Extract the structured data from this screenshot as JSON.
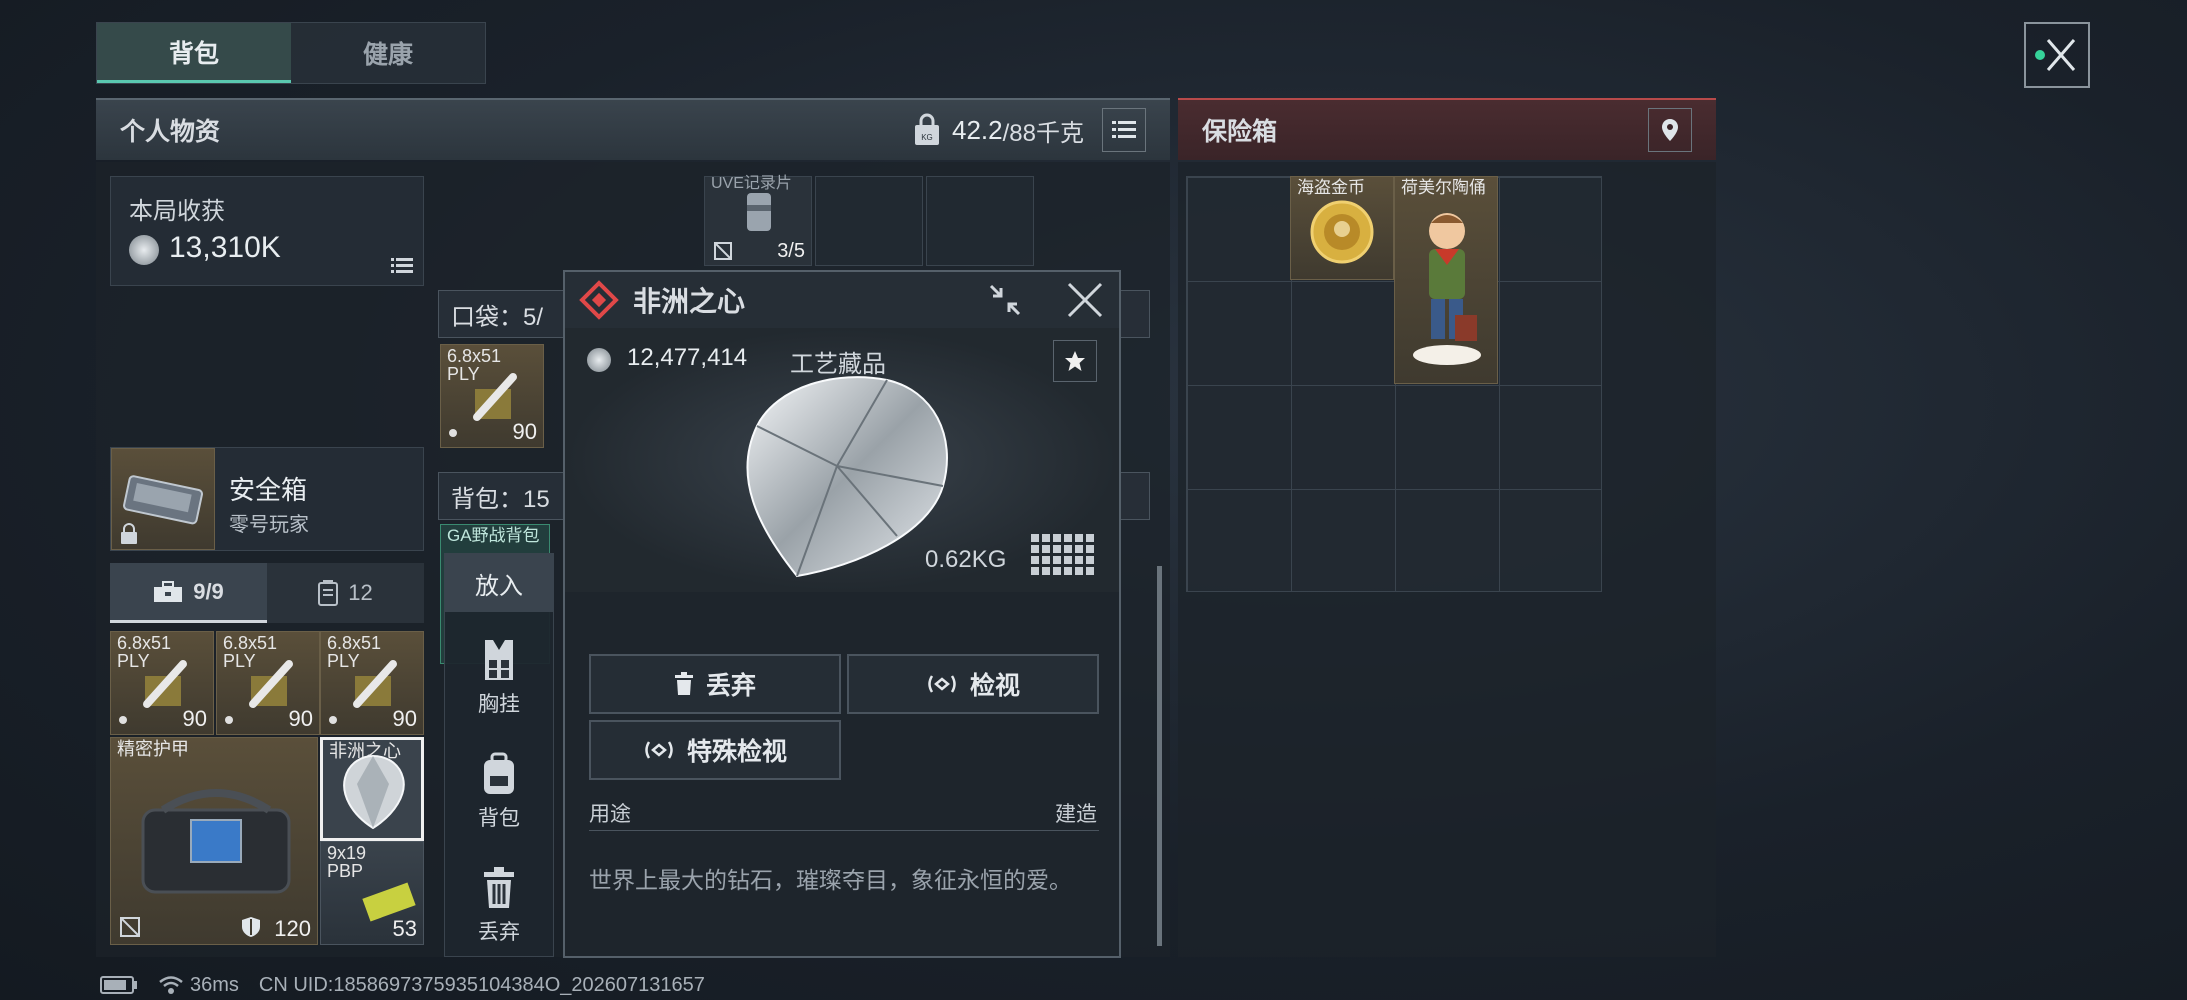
{
  "tabs": [
    {
      "label": "背包",
      "active": true
    },
    {
      "label": "健康",
      "active": false
    }
  ],
  "personal": {
    "title": "个人物资",
    "weight_current": "42.2",
    "weight_max": "/88千克",
    "harvest_label": "本局收获",
    "harvest_value": "13,310K",
    "safe_box": {
      "name": "安全箱",
      "owner": "零号玩家"
    },
    "loadout_tabs": [
      {
        "label": "9/9",
        "icon": "briefcase-icon"
      },
      {
        "label": "12",
        "icon": "locker-icon"
      }
    ],
    "top_item": {
      "label": "UVE记录片",
      "count": "3/5"
    },
    "pocket_label": "口袋：5/",
    "backpack_label": "背包：15",
    "pocket_item": {
      "label": "6.8x51\nPLY",
      "count": "90"
    },
    "rig_label": "GA野战背包",
    "grid_items": [
      {
        "label": "6.8x51\nPLY",
        "count": "90"
      },
      {
        "label": "6.8x51\nPLY",
        "count": "90"
      },
      {
        "label": "6.8x51\nPLY",
        "count": "90"
      }
    ],
    "armor": {
      "label": "精密护甲",
      "durability": "120"
    },
    "heart_item": {
      "label": "非洲之心"
    },
    "ammo_item": {
      "label": "9x19\nPBP",
      "count": "53"
    }
  },
  "actions": {
    "put_in": "放入",
    "items": [
      {
        "label": "胸挂",
        "icon": "vest-icon"
      },
      {
        "label": "背包",
        "icon": "backpack-icon"
      },
      {
        "label": "丢弃",
        "icon": "trash-icon"
      }
    ]
  },
  "popup": {
    "title": "非洲之心",
    "price": "12,477,414",
    "category": "工艺藏品",
    "weight": "0.62KG",
    "buttons": {
      "discard": "丢弃",
      "inspect": "检视",
      "special_inspect": "特殊检视"
    },
    "usage_label": "用途",
    "usage_value": "建造",
    "description": "世界上最大的钻石，璀璨夺目，象征永恒的爱。"
  },
  "safe": {
    "title": "保险箱",
    "items": [
      {
        "label": "海盗金币"
      },
      {
        "label": "荷美尔陶俑"
      }
    ]
  },
  "status": {
    "ping": "36ms",
    "uid": "CN UID:1858697375935104384O_202607131657"
  },
  "colors": {
    "accent_teal": "#5ac8b0",
    "safe_red": "#b84a4a"
  }
}
